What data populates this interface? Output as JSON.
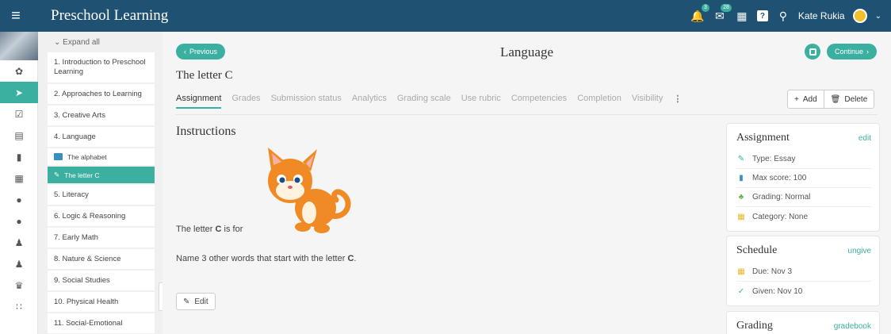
{
  "app": {
    "title": "Preschool Learning",
    "menu_icon": "hamburger-icon"
  },
  "topbar": {
    "notifications_badge": "3",
    "messages_badge": "28",
    "help_label": "?",
    "search_icon": "search-icon",
    "user_name": "Kate Rukia"
  },
  "rail": {
    "items": [
      "settings-icon",
      "send-icon",
      "check-square-icon",
      "calendar-grid-icon",
      "bar-chart-icon",
      "table-grid-icon",
      "user-icon",
      "user-icon",
      "users-icon",
      "users-icon",
      "trophy-icon",
      "grid-icon"
    ],
    "active_index": 1
  },
  "outline": {
    "expand_all": "Expand all",
    "items": [
      "1. Introduction to Preschool Learning",
      "2. Approaches to Learning",
      "3. Creative Arts",
      "4. Language",
      "5. Literacy",
      "6. Logic & Reasoning",
      "7. Early Math",
      "8. Nature & Science",
      "9. Social Studies",
      "10. Physical Health",
      "11. Social-Emotional"
    ],
    "subitems": [
      "The alphabet",
      "The letter C"
    ]
  },
  "main": {
    "prev_label": "Previous",
    "continue_label": "Continue",
    "page_title": "Language",
    "subtitle": "The letter C",
    "tabs": [
      "Assignment",
      "Grades",
      "Submission status",
      "Analytics",
      "Grading scale",
      "Use rubric",
      "Competencies",
      "Completion",
      "Visibility"
    ],
    "active_tab": "Assignment",
    "add_label": "Add",
    "delete_label": "Delete",
    "instructions_title": "Instructions",
    "letter_line_prefix": "The letter ",
    "letter_bold": "C",
    "letter_line_suffix": " is for",
    "name_line_prefix": "Name 3 other words that start with the letter ",
    "name_line_bold": "C",
    "name_line_suffix": ".",
    "edit_label": "Edit"
  },
  "assignment_card": {
    "title": "Assignment",
    "link": "edit",
    "rows": [
      "Type: Essay",
      "Max score: 100",
      "Grading: Normal",
      "Category: None"
    ]
  },
  "schedule_card": {
    "title": "Schedule",
    "link": "ungive",
    "rows": [
      "Due: Nov 3",
      "Given: Nov 10"
    ]
  },
  "grading_card": {
    "title": "Grading",
    "link": "gradebook"
  },
  "colors": {
    "topbar": "#1f5272",
    "accent": "#3bb0a0"
  }
}
